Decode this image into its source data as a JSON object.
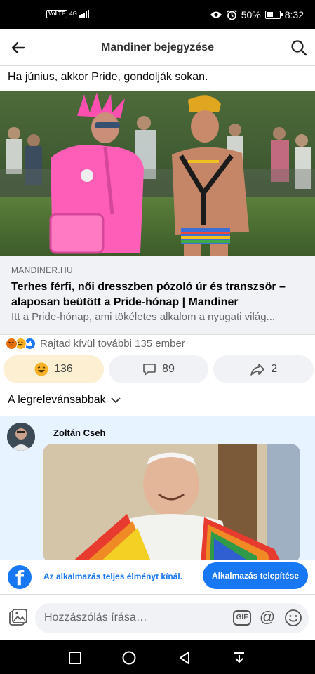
{
  "status": {
    "volte": "VoLTE",
    "network": "4G",
    "battery": "50%",
    "time": "8:32",
    "icons": [
      "eye-icon",
      "alarm-icon",
      "battery-icon",
      "signal-icon"
    ]
  },
  "header": {
    "title": "Mandiner bejegyzése",
    "back_icon": "back-arrow-icon",
    "search_icon": "search-icon"
  },
  "post": {
    "text": "Ha június, akkor Pride, gondolják sokan."
  },
  "link": {
    "domain": "MANDINER.HU",
    "headline": "Terhes férfi, női dresszben pózoló úr és transzsör – alaposan beütött a Pride-hónap | Mandiner",
    "description": "Itt a Pride-hónap, ami tökéletes alkalom a nyugati világ..."
  },
  "reactions": {
    "summary": "Rajtad kívül további 135 ember",
    "icons": [
      "angry-icon",
      "haha-icon",
      "like-icon"
    ],
    "colors": {
      "angry": "#e9710f",
      "haha": "#f7b125",
      "like": "#1877f2"
    }
  },
  "actions": {
    "reaction_count": "136",
    "comment_count": "89",
    "share_count": "2"
  },
  "sort": {
    "label": "A legrelevánsabbak"
  },
  "comment": {
    "author": "Zoltán Cseh"
  },
  "banner": {
    "text": "Az alkalmazás teljes élményt kínál.",
    "button": "Alkalmazás telepítése",
    "logo": "f"
  },
  "composer": {
    "placeholder": "Hozzászólás írása…",
    "gif_label": "GIF",
    "at_label": "@"
  },
  "navbar": {
    "icons": [
      "recent-apps-icon",
      "home-icon",
      "back-icon",
      "notification-pull-icon"
    ]
  },
  "colors": {
    "brand": "#1877f2",
    "comment_bg": "#e7f3ff",
    "active_reaction_bg": "#fcefd2"
  }
}
